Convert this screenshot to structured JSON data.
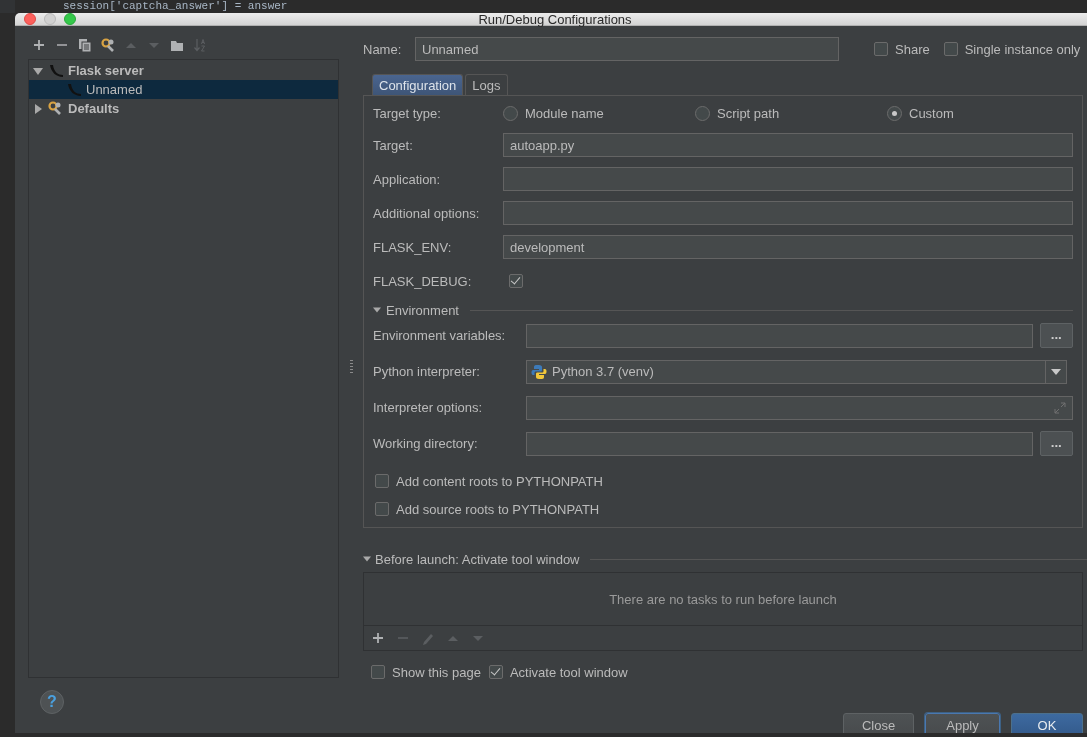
{
  "editor": {
    "code_line": "session['captcha_answer'] = answer"
  },
  "window": {
    "title": "Run/Debug Configurations"
  },
  "toolbar": [
    {
      "kind": "add",
      "disabled": false
    },
    {
      "kind": "remove",
      "disabled": false
    },
    {
      "kind": "copy",
      "disabled": false
    },
    {
      "kind": "wrench",
      "disabled": false
    },
    {
      "kind": "up",
      "disabled": true
    },
    {
      "kind": "down",
      "disabled": true
    },
    {
      "kind": "folder",
      "disabled": false
    },
    {
      "kind": "sort",
      "disabled": true
    }
  ],
  "tree": [
    {
      "label": "Flask server",
      "kind": "server",
      "expanded": true,
      "selected": false,
      "children": [
        {
          "label": "Unnamed",
          "kind": "server",
          "selected": true
        }
      ]
    },
    {
      "label": "Defaults",
      "kind": "defaults",
      "expanded": false,
      "selected": false
    }
  ],
  "help": {
    "label": "?"
  },
  "name": {
    "label": "Name:",
    "value": "Unnamed"
  },
  "header_options": [
    {
      "label": "Share",
      "checked": false
    },
    {
      "label": "Single instance only",
      "checked": false
    }
  ],
  "tabs": [
    {
      "label": "Configuration",
      "selected": true
    },
    {
      "label": "Logs",
      "selected": false
    }
  ],
  "target_type": {
    "label": "Target type:",
    "options": [
      {
        "label": "Module name",
        "selected": false
      },
      {
        "label": "Script path",
        "selected": false
      },
      {
        "label": "Custom",
        "selected": true
      }
    ]
  },
  "fields": [
    {
      "kind": "text",
      "label": "Target:",
      "value": "autoapp.py"
    },
    {
      "kind": "text",
      "label": "Application:"
    },
    {
      "kind": "text",
      "label": "Additional options:"
    },
    {
      "kind": "text",
      "label": "FLASK_ENV:",
      "value": "development"
    },
    {
      "kind": "checkbox",
      "label": "FLASK_DEBUG:",
      "checked": true
    }
  ],
  "environment": {
    "label": "Environment",
    "expanded": true,
    "fields": [
      {
        "kind": "browse",
        "label": "Environment variables:",
        "button": "..."
      },
      {
        "kind": "combo",
        "label": "Python interpreter:",
        "value": "Python 3.7 (venv)"
      },
      {
        "kind": "expand",
        "label": "Interpreter options:"
      },
      {
        "kind": "browse",
        "label": "Working directory:",
        "button": "..."
      }
    ]
  },
  "path_options": [
    {
      "label": "Add content roots to PYTHONPATH",
      "checked": false
    },
    {
      "label": "Add source roots to PYTHONPATH",
      "checked": false
    }
  ],
  "before_launch": {
    "label": "Before launch: Activate tool window",
    "expanded": true,
    "empty_text": "There are no tasks to run before launch",
    "toolbar": [
      {
        "kind": "add",
        "disabled": false
      },
      {
        "kind": "remove",
        "disabled": true
      },
      {
        "kind": "edit",
        "disabled": true
      },
      {
        "kind": "up",
        "disabled": true
      },
      {
        "kind": "down",
        "disabled": true
      }
    ]
  },
  "launch_options": [
    {
      "label": "Show this page",
      "checked": false
    },
    {
      "label": "Activate tool window",
      "checked": true
    }
  ],
  "buttons": [
    {
      "label": "Close",
      "kind": "normal"
    },
    {
      "label": "Apply",
      "kind": "focused"
    },
    {
      "label": "OK",
      "kind": "default"
    }
  ]
}
